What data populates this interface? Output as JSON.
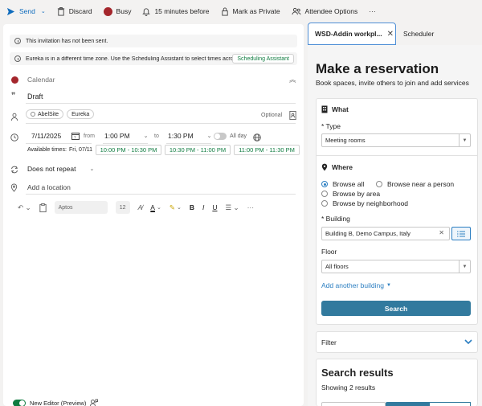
{
  "toolbar": {
    "send": "Send",
    "discard": "Discard",
    "busy": "Busy",
    "reminder": "15 minutes before",
    "private": "Mark as Private",
    "attendee_options": "Attendee Options",
    "more": "···"
  },
  "notices": {
    "not_sent": "This invitation has not been sent.",
    "timezone": "Eureka is in a different time zone. Use the Scheduling Assistant to select times acro...",
    "scheduling_assistant": "Scheduling Assistant"
  },
  "compose": {
    "calendar_placeholder": "Calendar",
    "title": "Draft",
    "attendees": [
      "AbelSite",
      "Eureka"
    ],
    "optional": "Optional",
    "start_date": "7/11/2025",
    "from_label": "from",
    "start_time": "1:00 PM",
    "to_label": "to",
    "end_time": "1:30 PM",
    "all_day": "All day",
    "available_label": "Available times:",
    "available_date": "Fri, 07/11",
    "slots": [
      "10:00 PM - 10:30 PM",
      "10:30 PM - 11:00 PM",
      "11:00 PM - 11:30 PM"
    ],
    "repeat": "Does not repeat",
    "location_placeholder": "Add a location",
    "font": "Aptos",
    "font_size": "12",
    "new_editor": "New Editor (Preview)"
  },
  "tabs": {
    "active": "WSD-Addin workpl...",
    "inactive": "Scheduler"
  },
  "addin": {
    "title": "Make a reservation",
    "subtitle": "Book spaces, invite others to join and add services",
    "what": {
      "heading": "What",
      "type_label": "* Type",
      "type_value": "Meeting rooms"
    },
    "where": {
      "heading": "Where",
      "options": [
        "Browse all",
        "Browse near a person",
        "Browse by area",
        "Browse by neighborhood"
      ],
      "building_label": "* Building",
      "building_value": "Building B, Demo Campus, Italy",
      "floor_label": "Floor",
      "floor_value": "All floors",
      "add_building": "Add another building",
      "search": "Search"
    },
    "filter": "Filter",
    "results": {
      "heading": "Search results",
      "count": "Showing 2 results"
    }
  },
  "colors": {
    "accent": "#0f6cbd",
    "green": "#107c41",
    "busy": "#a4262c",
    "search_button": "#327a9e"
  }
}
